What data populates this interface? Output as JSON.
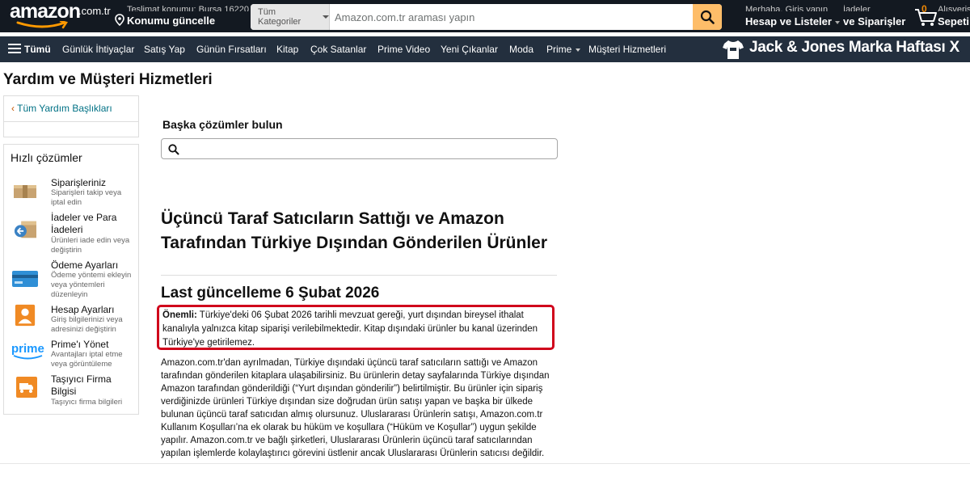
{
  "header": {
    "logo_text": "amazon",
    "logo_tld": ".com.tr",
    "deliver_line1": "Teslimat konumu: Bursa 16220",
    "deliver_line2": "Konumu güncelle",
    "search_category": "Tüm Kategoriler",
    "search_placeholder": "Amazon.com.tr araması yapın",
    "account_line1": "Merhaba, Giriş yapın",
    "account_line2": "Hesap ve Listeler",
    "orders_line1": "İadeler",
    "orders_line2": "ve Siparişler",
    "cart_count": "0",
    "cart_line1": "Alışveriş",
    "cart_line2": "Sepeti"
  },
  "nav": {
    "all": "Tümü",
    "items": [
      "Günlük İhtiyaçlar",
      "Satış Yap",
      "Günün Fırsatları",
      "Kitap",
      "Çok Satanlar",
      "Prime Video",
      "Yeni Çıkanlar",
      "Moda",
      "Prime",
      "Müşteri Hizmetleri"
    ],
    "promo": "Jack & Jones Marka Haftası X"
  },
  "page": {
    "title": "Yardım ve Müşteri Hizmetleri"
  },
  "sidebar": {
    "back_link": "Tüm Yardım Başlıkları",
    "quick_title": "Hızlı çözümler",
    "items": [
      {
        "title": "Siparişleriniz",
        "desc": "Siparişleri takip veya iptal edin",
        "icon": "package-icon"
      },
      {
        "title": "İadeler ve Para İadeleri",
        "desc": "Ürünleri iade edin veya değiştirin",
        "icon": "return-box-icon"
      },
      {
        "title": "Ödeme Ayarları",
        "desc": "Ödeme yöntemi ekleyin veya yöntemleri düzenleyin",
        "icon": "credit-card-icon"
      },
      {
        "title": "Hesap Ayarları",
        "desc": "Giriş bilgilerinizi veya adresinizi değiştirin",
        "icon": "user-icon"
      },
      {
        "title": "Prime'ı Yönet",
        "desc": "Avantajları iptal etme veya görüntüleme",
        "icon": "prime-icon"
      },
      {
        "title": "Taşıyıcı Firma Bilgisi",
        "desc": "Taşıyıcı firma bilgileri",
        "icon": "truck-icon"
      }
    ]
  },
  "main": {
    "other_solutions": "Başka çözümler bulun",
    "article_title": "Üçüncü Taraf Satıcıların Sattığı ve Amazon Tarafından Türkiye Dışından Gönderilen Ürünler",
    "updated": "Last güncelleme 6 Şubat 2026",
    "notice_label": "Önemli:",
    "notice_text": " Türkiye'deki 06 Şubat 2026 tarihli mevzuat gereği, yurt dışından bireysel ithalat kanalıyla yalnızca kitap siparişi verilebilmektedir. Kitap dışındaki ürünler bu kanal üzerinden Türkiye'ye getirilemez.",
    "body": "Amazon.com.tr'dan ayrılmadan, Türkiye dışındaki üçüncü taraf satıcıların sattığı ve Amazon tarafından gönderilen kitaplara ulaşabilirsiniz. Bu ürünlerin detay sayfalarında Türkiye dışından Amazon tarafından gönderildiği (“Yurt dışından gönderilir”) belirtilmiştir. Bu ürünler için sipariş verdiğinizde ürünleri Türkiye dışından size doğrudan ürün satışı yapan ve başka bir ülkede bulunan üçüncü taraf satıcıdan almış olursunuz. Uluslararası Ürünlerin satışı, Amazon.com.tr Kullanım Koşulları’na ek olarak bu hüküm ve koşullara (“Hüküm ve Koşullar”) uygun şekilde yapılır. Amazon.com.tr ve bağlı şirketleri, Uluslararası Ürünlerin üçüncü taraf satıcılarından yapılan işlemlerde kolaylaştırıcı görevini üstlenir ancak Uluslararası Ürünlerin satıcısı değildir."
  },
  "colors": {
    "header_bg": "#131921",
    "nav_bg": "#232f3e",
    "search_button": "#febd69",
    "link": "#007185",
    "notice_border": "#d0021b"
  }
}
